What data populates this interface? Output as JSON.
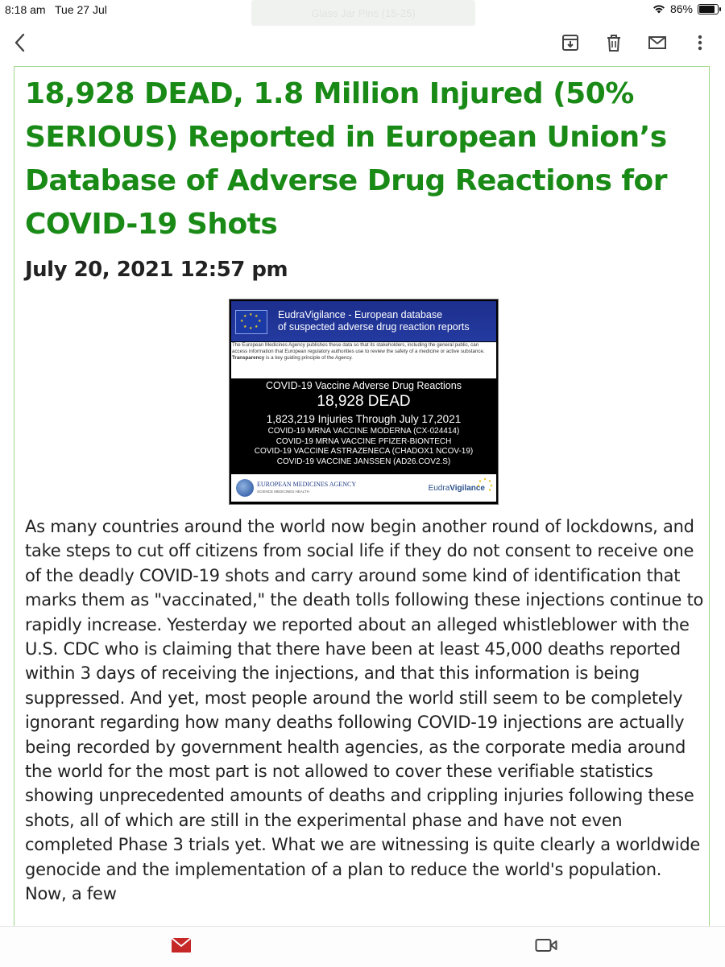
{
  "status_bar": {
    "time": "8:18 am",
    "date": "Tue 27 Jul",
    "tab_hint": "Glass Jar Pins (15-25)",
    "battery": "86%"
  },
  "toolbar": {
    "icons": [
      "back-icon",
      "archive-icon",
      "trash-icon",
      "mail-icon",
      "more-icon"
    ]
  },
  "article": {
    "headline": "18,928 DEAD, 1.8 Million Injured (50% SERIOUS) Reported in European Union’s Database of Adverse Drug Reactions for COVID-19 Shots",
    "date": "July 20, 2021 12:57 pm",
    "image": {
      "header_line1": "EudraVigilance - European database",
      "header_line2": "of suspected adverse drug reaction reports",
      "notice": "The European Medicines Agency publishes these data so that its stakeholders, including the general public, can access information that European regulatory authorities use to review the safety of a medicine or active substance.",
      "notice_bold": "Transparency",
      "notice_tail": "is a key guiding principle of the Agency.",
      "line1": "COVID-19 Vaccine Adverse Drug Reactions",
      "line2": "18,928 DEAD",
      "line3": "1,823,219 Injuries Through  July 17,2021",
      "vaccines": [
        "COVID-19 MRNA VACCINE MODERNA (CX-024414)",
        "COVID-19 MRNA VACCINE PFIZER-BIONTECH",
        "COVID-19 VACCINE ASTRAZENECA (CHADOX1 NCOV-19)",
        "COVID-19 VACCINE JANSSEN (AD26.COV2.S)"
      ],
      "ema_name": "EUROPEAN MEDICINES AGENCY",
      "ema_tagline": "SCIENCE  MEDICINES  HEALTH",
      "eudra_a": "Eudra",
      "eudra_b": "Vigilance"
    },
    "body": "As many countries around the world now begin another round of lockdowns, and take steps to cut off citizens from social life if they do not consent to receive one of the deadly COVID-19 shots and carry around some kind of identification that marks them as \"vaccinated,\" the death tolls following these injections continue to rapidly increase. Yesterday we reported about an alleged whistleblower with the U.S. CDC who is claiming that there have been at least 45,000 deaths reported within 3 days of receiving the injections, and that this information is being suppressed. And yet, most people around the world still seem to be completely ignorant regarding how many deaths following COVID-19 injections are actually being recorded by government health agencies, as the corporate media around the world for the most part is not allowed to cover these verifiable statistics showing unprecedented amounts of deaths and crippling injuries following these shots, all of which are still in the experimental phase and have not even completed Phase 3 trials yet. What we are witnessing is quite clearly a worldwide genocide and the implementation of a plan to reduce the world's population. Now, a few"
  },
  "bottom_bar": {
    "icons": [
      "mail-icon",
      "video-icon"
    ]
  },
  "colors": {
    "headline": "#1a8a17",
    "frame_border": "#9fd78a",
    "mail_red": "#c62828"
  }
}
